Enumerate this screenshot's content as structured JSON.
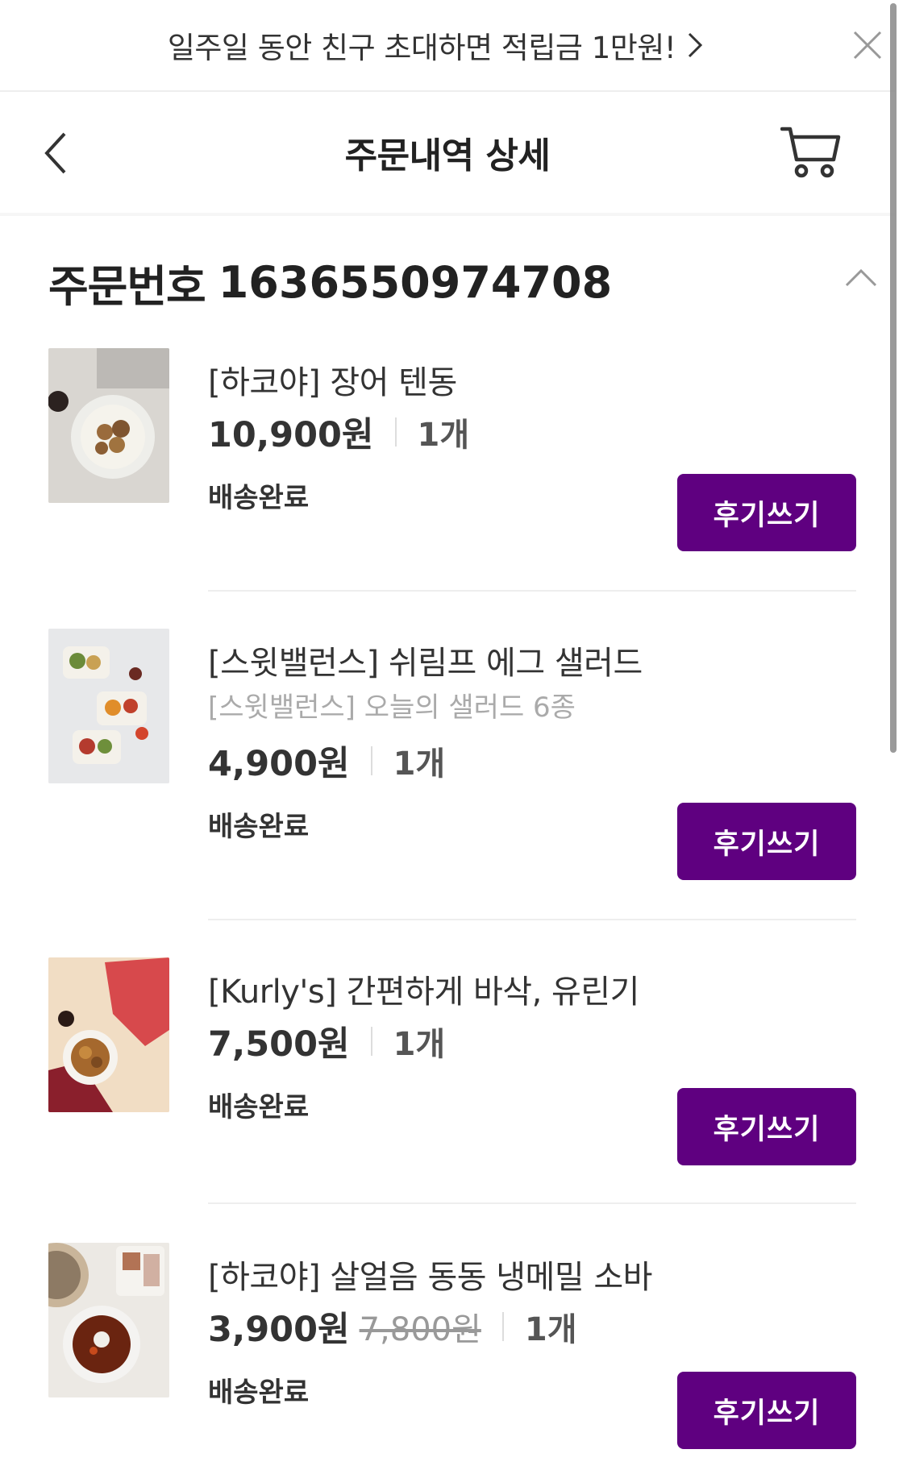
{
  "banner": {
    "text": "일주일 동안 친구 초대하면 적립금 1만원!",
    "arrow_icon": "chevron-right-icon",
    "close_icon": "close-icon"
  },
  "header": {
    "title": "주문내역 상세",
    "back_icon": "chevron-left-icon",
    "cart_icon": "cart-icon"
  },
  "order": {
    "label": "주문번호",
    "number": "1636550974708",
    "toggle_icon": "chevron-up-icon"
  },
  "items": [
    {
      "name": "[하코야] 장어 텐동",
      "option": "",
      "price": "10,900원",
      "original_price": "",
      "quantity": "1개",
      "status": "배송완료",
      "review_label": "후기쓰기"
    },
    {
      "name": "[스윗밸런스] 쉬림프 에그 샐러드",
      "option": "[스윗밸런스] 오늘의 샐러드 6종",
      "price": "4,900원",
      "original_price": "",
      "quantity": "1개",
      "status": "배송완료",
      "review_label": "후기쓰기"
    },
    {
      "name": "[Kurly's] 간편하게 바삭, 유린기",
      "option": "",
      "price": "7,500원",
      "original_price": "",
      "quantity": "1개",
      "status": "배송완료",
      "review_label": "후기쓰기"
    },
    {
      "name": "[하코야] 살얼음 동동 냉메밀 소바",
      "option": "",
      "price": "3,900원",
      "original_price": "7,800원",
      "quantity": "1개",
      "status": "배송완료",
      "review_label": "후기쓰기"
    }
  ],
  "colors": {
    "accent": "#5f0080",
    "divider": "#eeeeee",
    "muted_text": "#aaaaaa"
  }
}
